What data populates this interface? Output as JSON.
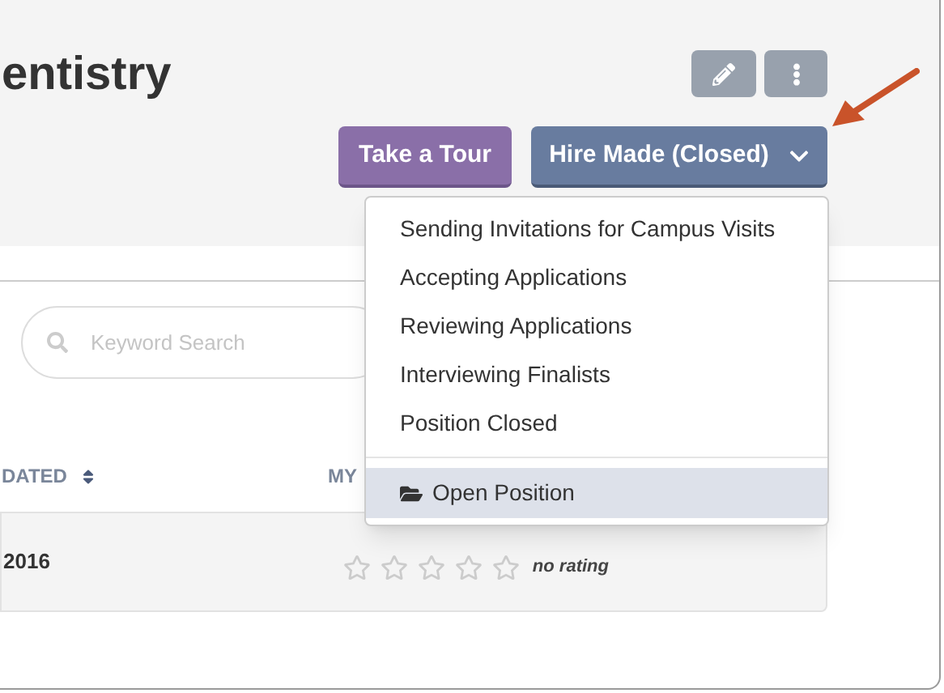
{
  "header": {
    "title": "entistry",
    "tour_button": "Take a Tour",
    "status_button": "Hire Made (Closed)"
  },
  "status_menu": {
    "items": [
      {
        "label": "Sending Invitations for Campus Visits",
        "selected": false
      },
      {
        "label": "Accepting Applications",
        "selected": false
      },
      {
        "label": "Reviewing Applications",
        "selected": false
      },
      {
        "label": "Interviewing Finalists",
        "selected": false
      },
      {
        "label": "Position Closed",
        "selected": false
      }
    ],
    "action": {
      "label": "Open Position",
      "selected": true
    }
  },
  "search": {
    "placeholder": "Keyword Search"
  },
  "table": {
    "columns": [
      "DATED",
      "MY"
    ],
    "rows": [
      {
        "date": "2016",
        "stars": 0,
        "rating_label": "no rating"
      }
    ]
  }
}
